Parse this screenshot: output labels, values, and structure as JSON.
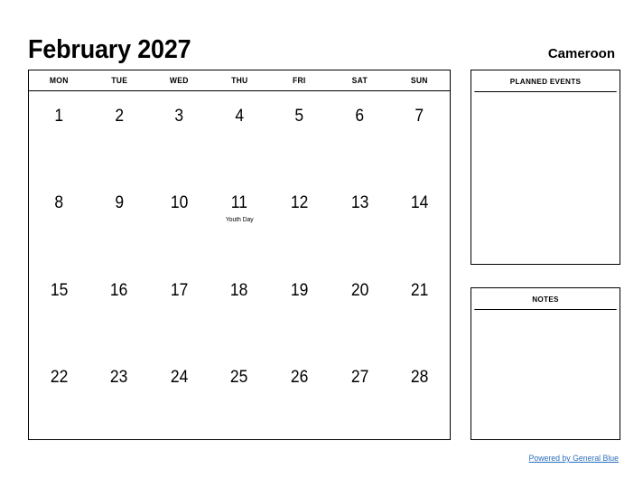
{
  "header": {
    "title": "February 2027",
    "country": "Cameroon"
  },
  "calendar": {
    "day_names": [
      "MON",
      "TUE",
      "WED",
      "THU",
      "FRI",
      "SAT",
      "SUN"
    ],
    "weeks": [
      [
        {
          "day": "1",
          "event": ""
        },
        {
          "day": "2",
          "event": ""
        },
        {
          "day": "3",
          "event": ""
        },
        {
          "day": "4",
          "event": ""
        },
        {
          "day": "5",
          "event": ""
        },
        {
          "day": "6",
          "event": ""
        },
        {
          "day": "7",
          "event": ""
        }
      ],
      [
        {
          "day": "8",
          "event": ""
        },
        {
          "day": "9",
          "event": ""
        },
        {
          "day": "10",
          "event": ""
        },
        {
          "day": "11",
          "event": "Youth Day"
        },
        {
          "day": "12",
          "event": ""
        },
        {
          "day": "13",
          "event": ""
        },
        {
          "day": "14",
          "event": ""
        }
      ],
      [
        {
          "day": "15",
          "event": ""
        },
        {
          "day": "16",
          "event": ""
        },
        {
          "day": "17",
          "event": ""
        },
        {
          "day": "18",
          "event": ""
        },
        {
          "day": "19",
          "event": ""
        },
        {
          "day": "20",
          "event": ""
        },
        {
          "day": "21",
          "event": ""
        }
      ],
      [
        {
          "day": "22",
          "event": ""
        },
        {
          "day": "23",
          "event": ""
        },
        {
          "day": "24",
          "event": ""
        },
        {
          "day": "25",
          "event": ""
        },
        {
          "day": "26",
          "event": ""
        },
        {
          "day": "27",
          "event": ""
        },
        {
          "day": "28",
          "event": ""
        }
      ]
    ]
  },
  "panels": {
    "planned_events": {
      "title": "PLANNED EVENTS",
      "content": ""
    },
    "notes": {
      "title": "NOTES",
      "content": ""
    }
  },
  "footer": {
    "link_text": "Powered by General Blue",
    "link_color": "#2a6ebb"
  }
}
